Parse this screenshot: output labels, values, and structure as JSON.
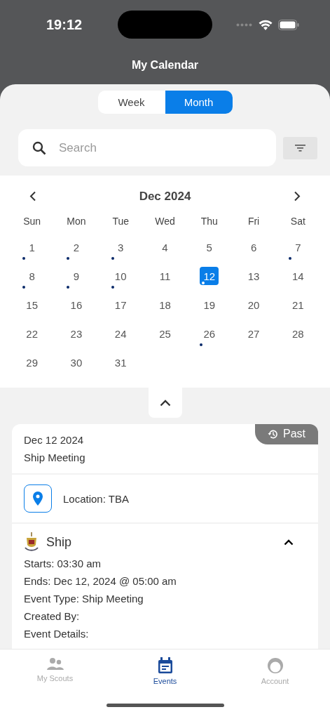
{
  "status_bar": {
    "time": "19:12"
  },
  "header": {
    "title": "My Calendar"
  },
  "view_toggle": [
    {
      "label": "Week",
      "selected": false
    },
    {
      "label": "Month",
      "selected": true
    }
  ],
  "search": {
    "placeholder": "Search"
  },
  "calendar": {
    "month": "Dec 2024",
    "weekdays": [
      "Sun",
      "Mon",
      "Tue",
      "Wed",
      "Thu",
      "Fri",
      "Sat"
    ],
    "weeks": [
      [
        {
          "day": "1",
          "has_event": true,
          "selected": false
        },
        {
          "day": "2",
          "has_event": true,
          "selected": false
        },
        {
          "day": "3",
          "has_event": true,
          "selected": false
        },
        {
          "day": "4",
          "has_event": false,
          "selected": false
        },
        {
          "day": "5",
          "has_event": false,
          "selected": false
        },
        {
          "day": "6",
          "has_event": false,
          "selected": false
        },
        {
          "day": "7",
          "has_event": true,
          "selected": false
        }
      ],
      [
        {
          "day": "8",
          "has_event": true,
          "selected": false
        },
        {
          "day": "9",
          "has_event": true,
          "selected": false
        },
        {
          "day": "10",
          "has_event": true,
          "selected": false
        },
        {
          "day": "11",
          "has_event": false,
          "selected": false
        },
        {
          "day": "12",
          "has_event": true,
          "selected": true
        },
        {
          "day": "13",
          "has_event": false,
          "selected": false
        },
        {
          "day": "14",
          "has_event": false,
          "selected": false
        }
      ],
      [
        {
          "day": "15",
          "has_event": false,
          "selected": false
        },
        {
          "day": "16",
          "has_event": false,
          "selected": false
        },
        {
          "day": "17",
          "has_event": false,
          "selected": false
        },
        {
          "day": "18",
          "has_event": false,
          "selected": false
        },
        {
          "day": "19",
          "has_event": false,
          "selected": false
        },
        {
          "day": "20",
          "has_event": false,
          "selected": false
        },
        {
          "day": "21",
          "has_event": false,
          "selected": false
        }
      ],
      [
        {
          "day": "22",
          "has_event": false,
          "selected": false
        },
        {
          "day": "23",
          "has_event": false,
          "selected": false
        },
        {
          "day": "24",
          "has_event": false,
          "selected": false
        },
        {
          "day": "25",
          "has_event": false,
          "selected": false
        },
        {
          "day": "26",
          "has_event": true,
          "selected": false
        },
        {
          "day": "27",
          "has_event": false,
          "selected": false
        },
        {
          "day": "28",
          "has_event": false,
          "selected": false
        }
      ],
      [
        {
          "day": "29",
          "has_event": false,
          "selected": false
        },
        {
          "day": "30",
          "has_event": false,
          "selected": false
        },
        {
          "day": "31",
          "has_event": false,
          "selected": false
        }
      ]
    ]
  },
  "event": {
    "date": "Dec 12 2024",
    "title": "Ship Meeting",
    "badge": "Past",
    "location": "Location: TBA",
    "unit": "Ship",
    "expanded": true,
    "details": [
      "Starts: 03:30 am",
      "Ends: Dec 12, 2024 @ 05:00 am",
      "Event Type: Ship Meeting",
      "Created By:",
      "Event Details:"
    ]
  },
  "tab_bar": [
    {
      "label": "My Scouts",
      "kind": "people",
      "selected": false
    },
    {
      "label": "Events",
      "kind": "calendar",
      "selected": true
    },
    {
      "label": "Account",
      "kind": "avatar",
      "selected": false
    }
  ]
}
